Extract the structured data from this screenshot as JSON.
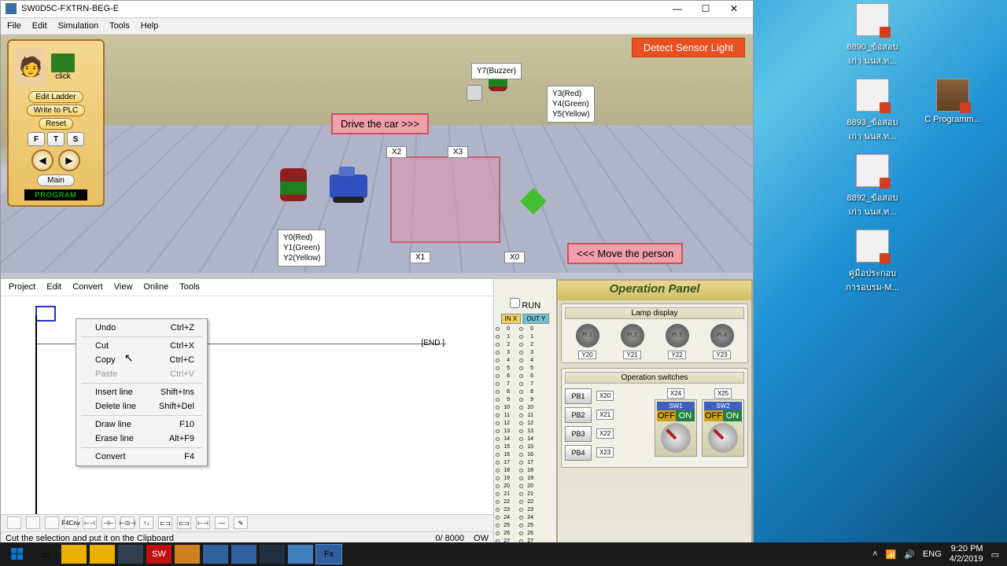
{
  "window": {
    "title": "SW0D5C-FXTRN-BEG-E",
    "min": "—",
    "max": "☐",
    "close": "✕"
  },
  "menubar": [
    "File",
    "Edit",
    "Simulation",
    "Tools",
    "Help"
  ],
  "control": {
    "click": "click",
    "editLadder": "Edit Ladder",
    "writePlc": "Write to PLC",
    "reset": "Reset",
    "f": "F",
    "t": "T",
    "s": "S",
    "left": "◀",
    "right": "▶",
    "main": "Main",
    "program": "PROGRAM"
  },
  "sim": {
    "sensorLabel": "Detect Sensor Light",
    "drive": "Drive the car >>>",
    "move": "<<< Move the person",
    "buzzer": "Y7(Buzzer)",
    "rightLights": "Y3(Red)\nY4(Green)\nY5(Yellow)",
    "leftLights": "Y0(Red)\nY1(Green)\nY2(Yellow)",
    "x2": "X2",
    "x3": "X3",
    "x1": "X1",
    "x0": "X0"
  },
  "editorMenu": [
    "Project",
    "Edit",
    "Convert",
    "View",
    "Online",
    "Tools"
  ],
  "ladder": {
    "end": "[END    ]"
  },
  "contextMenu": [
    {
      "label": "Undo",
      "shortcut": "Ctrl+Z"
    },
    {
      "sep": true
    },
    {
      "label": "Cut",
      "shortcut": "Ctrl+X"
    },
    {
      "label": "Copy",
      "shortcut": "Ctrl+C"
    },
    {
      "label": "Paste",
      "shortcut": "Ctrl+V",
      "disabled": true
    },
    {
      "sep": true
    },
    {
      "label": "Insert line",
      "shortcut": "Shift+Ins"
    },
    {
      "label": "Delete line",
      "shortcut": "Shift+Del"
    },
    {
      "sep": true
    },
    {
      "label": "Draw line",
      "shortcut": "F10"
    },
    {
      "label": "Erase line",
      "shortcut": "Alt+F9"
    },
    {
      "sep": true
    },
    {
      "label": "Convert",
      "shortcut": "F4"
    }
  ],
  "toolbarBottom": [
    "",
    "",
    "",
    "F4Cnv",
    "⊢⊣",
    "⊣⊢",
    "⊢⊙⊣",
    "↑↓",
    "⊏⊐",
    "⊏⊐",
    "⊢⊣",
    "—",
    "✎"
  ],
  "statusBar": {
    "text": "Cut the selection and put it on the Clipboard",
    "counter": "0/ 8000",
    "mode": "OW"
  },
  "io": {
    "run": "RUN",
    "inx": "IN X",
    "outy": "OUT Y",
    "count": 28
  },
  "opPanel": {
    "title": "Operation Panel",
    "lampTitle": "Lamp display",
    "lamps": [
      "PL1",
      "PL2",
      "PL3",
      "PL4"
    ],
    "lampTags": [
      "Y20",
      "Y21",
      "Y22",
      "Y23"
    ],
    "swTitle": "Operation switches",
    "pb": [
      "PB1",
      "PB2",
      "PB3",
      "PB4"
    ],
    "pbX": [
      "X20",
      "X21",
      "X22",
      "X23"
    ],
    "extraX": [
      "X24",
      "X25"
    ],
    "sw": [
      "SW1",
      "SW2"
    ],
    "off": "OFF",
    "on": "ON"
  },
  "desktopIcons": [
    {
      "label": "8890_ข้อสอบเก่า นนส.ท..."
    },
    {
      "label": "8893_ข้อสอบเก่า นนส.ท..."
    },
    {
      "label": "C Programm...",
      "img": true
    },
    {
      "label": "8892_ข้อสอบเก่า นนส.ท...",
      "sel": true
    },
    {
      "label": "คู่มือประกอบการอบรม-M..."
    }
  ],
  "tray": {
    "lang": "ENG",
    "time": "9:20 PM",
    "date": "4/2/2019"
  }
}
